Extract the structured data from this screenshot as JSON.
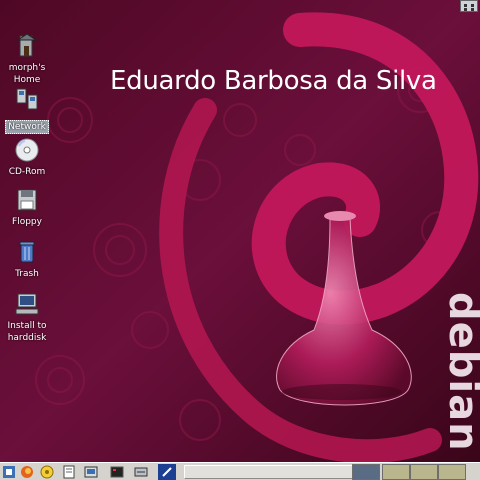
{
  "desktop": {
    "overlay_text": "Eduardo Barbosa da Silva",
    "brand_text": "debian",
    "colors": {
      "wallpaper": "#5c0a2e",
      "swirl": "#c2185b",
      "label_text": "#ffffff"
    },
    "icons": [
      {
        "label": "morph's Home",
        "icon": "home-icon",
        "selected": false
      },
      {
        "label": "Network",
        "icon": "network-icon",
        "selected": true
      },
      {
        "label": "CD-Rom",
        "icon": "cdrom-icon",
        "selected": false
      },
      {
        "label": "Floppy",
        "icon": "floppy-icon",
        "selected": false
      },
      {
        "label": "Trash",
        "icon": "trash-icon",
        "selected": false
      },
      {
        "label": "Install to harddisk",
        "icon": "computer-icon",
        "selected": false
      }
    ]
  },
  "taskbar": {
    "launchers": [
      "start-menu-icon",
      "firefox-icon",
      "konqueror-icon",
      "text-editor-icon",
      "file-manager-icon",
      "terminal-icon",
      "settings-icon",
      "edit-pen-icon"
    ],
    "virtual_desktops": 4,
    "active_desktop": 1
  }
}
